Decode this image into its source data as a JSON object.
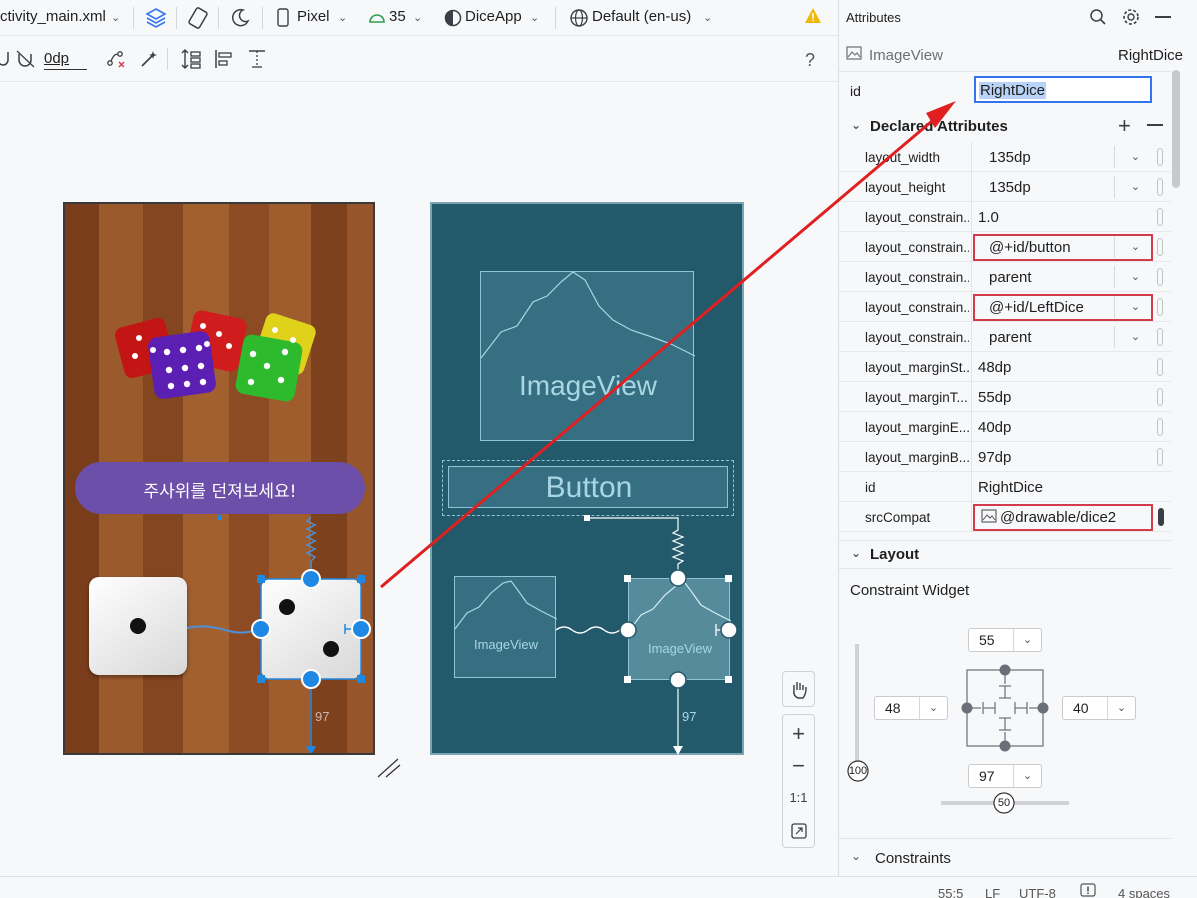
{
  "toolbar": {
    "file_tab": "ctivity_main.xml",
    "device": "Pixel",
    "api_level": "35",
    "theme": "DiceApp",
    "locale": "Default (en-us)",
    "margin_value": "0dp",
    "help": "?"
  },
  "design": {
    "button_text": "주사위를 던져보세요!",
    "margin_bottom_label": "97"
  },
  "blueprint": {
    "imageview_top": "ImageView",
    "button": "Button",
    "imageview_left": "ImageView",
    "imageview_right": "ImageView",
    "margin_bottom_label": "97"
  },
  "zoom_controls": {
    "plus": "+",
    "minus": "−",
    "ratio": "1:1"
  },
  "attributes": {
    "panel_title": "Attributes",
    "widget_type": "ImageView",
    "widget_name": "RightDice",
    "id_label": "id",
    "id_value": "RightDice",
    "declared_title": "Declared Attributes",
    "rows": [
      {
        "key": "layout_width",
        "value": "135dp"
      },
      {
        "key": "layout_height",
        "value": "135dp"
      },
      {
        "key": "layout_constrain...",
        "value": "1.0"
      },
      {
        "key": "layout_constrain...",
        "value": "@+id/button"
      },
      {
        "key": "layout_constrain...",
        "value": "parent"
      },
      {
        "key": "layout_constrain...",
        "value": "@+id/LeftDice"
      },
      {
        "key": "layout_constrain...",
        "value": "parent"
      },
      {
        "key": "layout_marginSt...",
        "value": "48dp"
      },
      {
        "key": "layout_marginT...",
        "value": "55dp"
      },
      {
        "key": "layout_marginE...",
        "value": "40dp"
      },
      {
        "key": "layout_marginB...",
        "value": "97dp"
      },
      {
        "key": "id",
        "value": "RightDice"
      },
      {
        "key": "srcCompat",
        "value": "@drawable/dice2"
      }
    ],
    "layout_title": "Layout",
    "constraint_widget": "Constraint Widget",
    "margin_top": "55",
    "margin_start": "48",
    "margin_end": "40",
    "margin_bottom": "97",
    "vertical_bias": "100",
    "horizontal_bias": "50",
    "constraints_title": "Constraints"
  },
  "status": {
    "position": "55:5",
    "line_ending": "LF",
    "encoding": "UTF-8",
    "indent": "4 spaces"
  },
  "colors": {
    "highlight": "#d33a4a",
    "arrow": "#e02020",
    "selection": "#1e88e5",
    "blueprint_bg": "#22596b",
    "button_purple": "#6b4fa8"
  }
}
